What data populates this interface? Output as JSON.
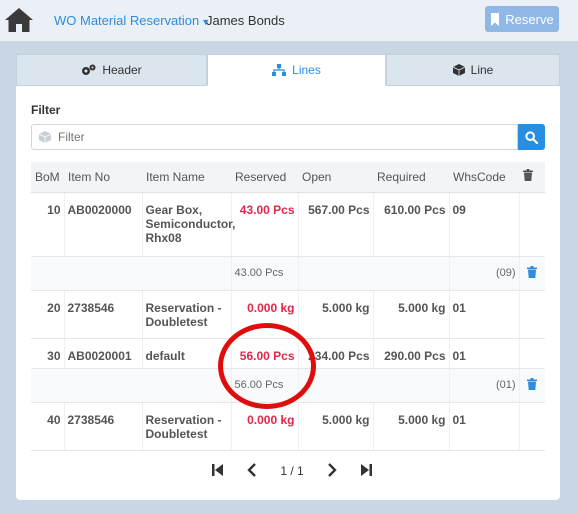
{
  "header": {
    "menu_label": "WO Material Reservation",
    "user_name": "James Bonds",
    "reserve_label": "Reserve"
  },
  "tabs": [
    {
      "label": "Header",
      "icon": "cogs-icon",
      "active": false
    },
    {
      "label": "Lines",
      "icon": "sitemap-icon",
      "active": true
    },
    {
      "label": "Line",
      "icon": "cube-icon",
      "active": false
    }
  ],
  "filter": {
    "label": "Filter",
    "placeholder": "Filter"
  },
  "table": {
    "columns": [
      "BoM",
      "Item No",
      "Item Name",
      "Reserved",
      "Open",
      "Required",
      "WhsCode",
      ""
    ],
    "rows": [
      {
        "bom": "10",
        "item_no": "AB0020000",
        "item_name": "Gear Box, Semiconductor, Rhx08",
        "reserved": "43.00 Pcs",
        "open": "567.00 Pcs",
        "required": "610.00 Pcs",
        "whs": "09",
        "sub": {
          "reserved": "43.00 Pcs",
          "whs": "(09)"
        }
      },
      {
        "bom": "20",
        "item_no": "2738546",
        "item_name": "Reservation - Doubletest",
        "reserved": "0.000 kg",
        "open": "5.000 kg",
        "required": "5.000 kg",
        "whs": "01"
      },
      {
        "bom": "30",
        "item_no": "AB0020001",
        "item_name": "default",
        "reserved": "56.00 Pcs",
        "open": "234.00 Pcs",
        "required": "290.00 Pcs",
        "whs": "01",
        "sub": {
          "reserved": "56.00 Pcs",
          "whs": "(01)"
        }
      },
      {
        "bom": "40",
        "item_no": "2738546",
        "item_name": "Reservation - Doubletest",
        "reserved": "0.000 kg",
        "open": "5.000 kg",
        "required": "5.000 kg",
        "whs": "01"
      }
    ]
  },
  "pager": {
    "text": "1 / 1"
  },
  "colors": {
    "accent": "#2a8ee0",
    "reserved": "#e2284a",
    "annotation": "#e00d0d"
  }
}
